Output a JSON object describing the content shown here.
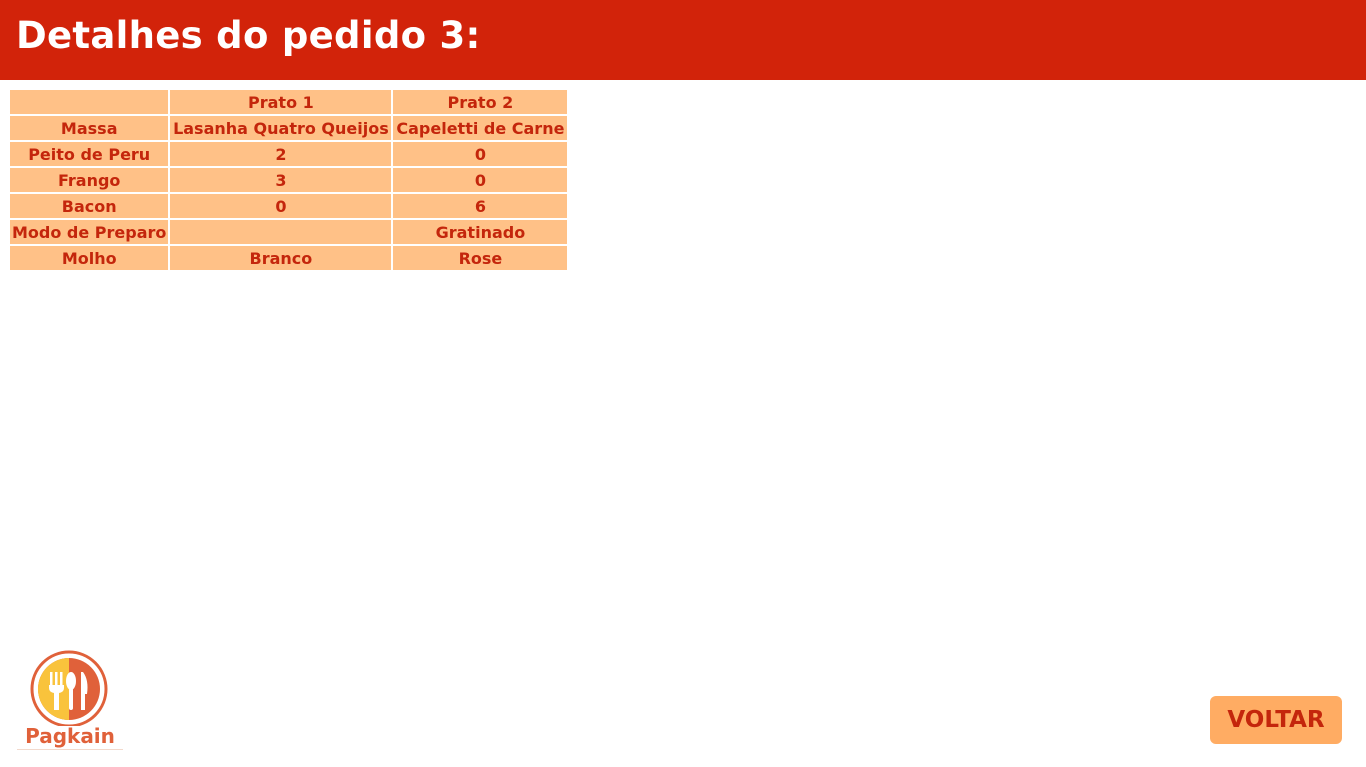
{
  "header": {
    "title": "Detalhes do pedido 3:"
  },
  "table": {
    "columns": [
      "",
      "Prato 1",
      "Prato 2"
    ],
    "rows": [
      {
        "label": "Massa",
        "prato1": "Lasanha Quatro Queijos",
        "prato2": "Capeletti de Carne"
      },
      {
        "label": "Peito de Peru",
        "prato1": "2",
        "prato2": "0"
      },
      {
        "label": "Frango",
        "prato1": "3",
        "prato2": "0"
      },
      {
        "label": "Bacon",
        "prato1": "0",
        "prato2": "6"
      },
      {
        "label": "Modo de Preparo",
        "prato1": "",
        "prato2": "Gratinado"
      },
      {
        "label": "Molho",
        "prato1": "Branco",
        "prato2": "Rose"
      }
    ]
  },
  "logo": {
    "text": "Pagkain",
    "icon": "fork-spoon-knife-icon"
  },
  "actions": {
    "back_label": "VOLTAR"
  },
  "colors": {
    "header_bg": "#d2230a",
    "cell_bg": "#ffc187",
    "cell_text": "#c4260c",
    "button_bg": "#ffac63"
  }
}
